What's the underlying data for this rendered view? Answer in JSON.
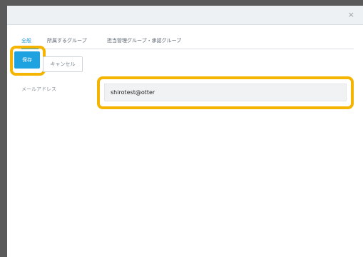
{
  "dialog": {
    "close_glyph": "×"
  },
  "tabs": [
    {
      "label": "全般"
    },
    {
      "label": "所属するグループ"
    },
    {
      "label": "担当管理グループ・承認グループ"
    }
  ],
  "buttons": {
    "save_label": "保存",
    "cancel_label": "キャンセル"
  },
  "form": {
    "email_label": "メールアドレス",
    "email_value": "shirotest@otter"
  },
  "colors": {
    "accent": "#1fa2e0",
    "highlight": "#f4b400"
  }
}
